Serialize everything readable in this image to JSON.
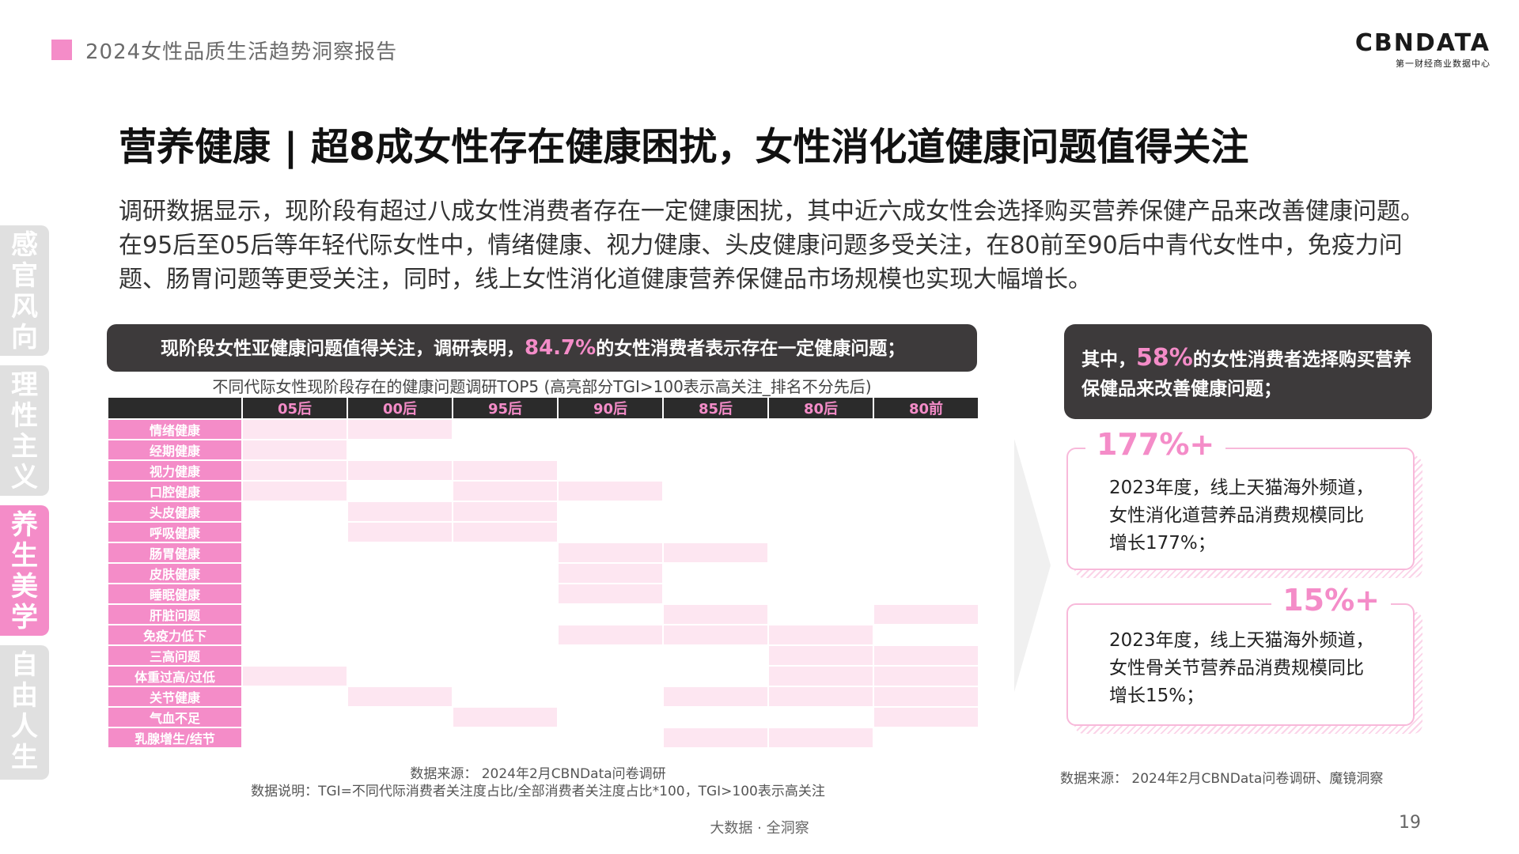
{
  "header": {
    "report_title": "2024女性品质生活趋势洞察报告",
    "logo_main": "CBNDATA",
    "logo_sub": "第一财经商业数据中心"
  },
  "nav": {
    "tabs": [
      {
        "label": "感官风向",
        "active": false
      },
      {
        "label": "理性主义",
        "active": false
      },
      {
        "label": "养生美学",
        "active": true
      },
      {
        "label": "自由人生",
        "active": false
      }
    ]
  },
  "main": {
    "title": "营养健康 | 超8成女性存在健康困扰，女性消化道健康问题值得关注",
    "intro": "调研数据显示，现阶段有超过八成女性消费者存在一定健康困扰，其中近六成女性会选择购买营养保健产品来改善健康问题。在95后至05后等年轻代际女性中，情绪健康、视力健康、头皮健康问题多受关注，在80前至90后中青代女性中，免疫力问题、肠胃问题等更受关注，同时，线上女性消化道健康营养保健品市场规模也实现大幅增长。"
  },
  "left_panel": {
    "banner_pre": "现阶段女性亚健康问题值得关注，调研表明，",
    "banner_highlight": "84.7%",
    "banner_post": "的女性消费者表示存在一定健康问题；",
    "table_caption": "不同代际女性现阶段存在的健康问题调研TOP5 (高亮部分TGI>100表示高关注_排名不分先后)",
    "generations": [
      "05后",
      "00后",
      "95后",
      "90后",
      "85后",
      "80后",
      "80前"
    ],
    "rows": [
      {
        "label": "情绪健康",
        "on": [
          1,
          1,
          0,
          0,
          0,
          0,
          0
        ]
      },
      {
        "label": "经期健康",
        "on": [
          1,
          0,
          0,
          0,
          0,
          0,
          0
        ]
      },
      {
        "label": "视力健康",
        "on": [
          1,
          1,
          1,
          0,
          0,
          0,
          0
        ]
      },
      {
        "label": "口腔健康",
        "on": [
          1,
          0,
          1,
          1,
          0,
          0,
          0
        ]
      },
      {
        "label": "头皮健康",
        "on": [
          0,
          1,
          1,
          0,
          0,
          0,
          0
        ]
      },
      {
        "label": "呼吸健康",
        "on": [
          0,
          1,
          1,
          0,
          0,
          0,
          0
        ]
      },
      {
        "label": "肠胃健康",
        "on": [
          0,
          0,
          0,
          1,
          1,
          0,
          0
        ]
      },
      {
        "label": "皮肤健康",
        "on": [
          0,
          0,
          0,
          1,
          0,
          0,
          0
        ]
      },
      {
        "label": "睡眠健康",
        "on": [
          0,
          0,
          0,
          1,
          0,
          0,
          0
        ]
      },
      {
        "label": "肝脏问题",
        "on": [
          0,
          0,
          0,
          0,
          1,
          0,
          1
        ]
      },
      {
        "label": "免疫力低下",
        "on": [
          0,
          0,
          0,
          1,
          1,
          1,
          0
        ]
      },
      {
        "label": "三高问题",
        "on": [
          0,
          0,
          0,
          0,
          0,
          1,
          1
        ]
      },
      {
        "label": "体重过高/过低",
        "on": [
          1,
          0,
          0,
          0,
          0,
          1,
          1
        ]
      },
      {
        "label": "关节健康",
        "on": [
          0,
          1,
          0,
          0,
          1,
          1,
          1
        ]
      },
      {
        "label": "气血不足",
        "on": [
          0,
          0,
          1,
          0,
          0,
          0,
          1
        ]
      },
      {
        "label": "乳腺增生/结节",
        "on": [
          0,
          0,
          0,
          0,
          1,
          1,
          0
        ]
      }
    ],
    "source_line1": "数据来源： 2024年2月CBNData问卷调研",
    "source_line2": "数据说明：TGI=不同代际消费者关注度占比/全部消费者关注度占比*100，TGI>100表示高关注"
  },
  "right_panel": {
    "banner_pre": "其中，",
    "banner_highlight": "58%",
    "banner_post": "的女性消费者选择购买营养保健品来改善健康问题；",
    "card1": {
      "number": "177%+",
      "line1": "2023年度，线上天猫海外频道，",
      "line2": "女性消化道营养品消费规模同比",
      "line3": "增长177%；"
    },
    "card2": {
      "number": "15%+",
      "line1": "2023年度，线上天猫海外频道，",
      "line2": "女性骨关节营养品消费规模同比",
      "line3": "增长15%；"
    },
    "source": "数据来源： 2024年2月CBNData问卷调研、魔镜洞察"
  },
  "footer": {
    "tagline": "大数据 · 全洞察",
    "page_number": "19"
  },
  "colors": {
    "accent_pink": "#f48cc8",
    "light_pink": "#fde6f1",
    "dark_banner": "#3d3a3b"
  }
}
